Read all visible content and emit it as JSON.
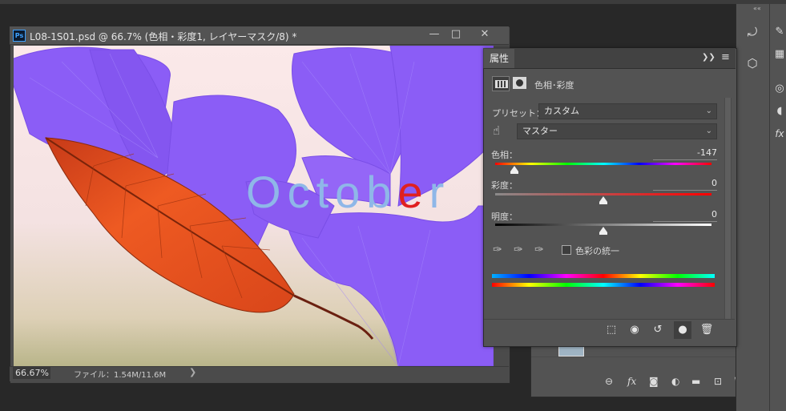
{
  "document": {
    "title": "L08-1S01.psd @ 66.7% (色相・彩度1, レイヤーマスク/8) *",
    "ps_logo": "Ps",
    "zoom": "66.67%",
    "file_info": "ファイル：1.54M/11.6M",
    "status_arrow": "❯",
    "window_buttons": [
      "—",
      "□",
      "✕"
    ],
    "canvas_text": [
      "O",
      "c",
      "t",
      "o",
      "b",
      "e",
      "r"
    ]
  },
  "properties": {
    "tab_label": "属性",
    "header_icons": [
      "❯❯",
      "≡"
    ],
    "adjustment_name": "色相･彩度",
    "preset_label": "プリセット：",
    "preset_value": "カスタム",
    "channel_value": "マスター",
    "hue_label": "色相：",
    "hue_value": "-147",
    "saturation_label": "彩度：",
    "saturation_value": "0",
    "lightness_label": "明度：",
    "lightness_value": "0",
    "colorize_label": "色彩の統一",
    "hue_slider_fraction": 0.09,
    "saturation_slider_fraction": 0.5,
    "lightness_slider_fraction": 0.5
  },
  "layers": {
    "bottom_icons": [
      "link-icon",
      "fx-icon",
      "mask-icon",
      "adjustment-icon",
      "folder-icon",
      "new-layer-icon",
      "trash-icon"
    ],
    "partial_percent": [
      "%",
      "%"
    ]
  },
  "dock": {
    "collapse": "««"
  },
  "colors": {
    "workspace": "#282828",
    "panel": "#535353",
    "ginkgo": "#8a5cf5",
    "leaf": "#e2481c",
    "october_text": "#8fb7e8",
    "october_accent": "#e02020"
  }
}
